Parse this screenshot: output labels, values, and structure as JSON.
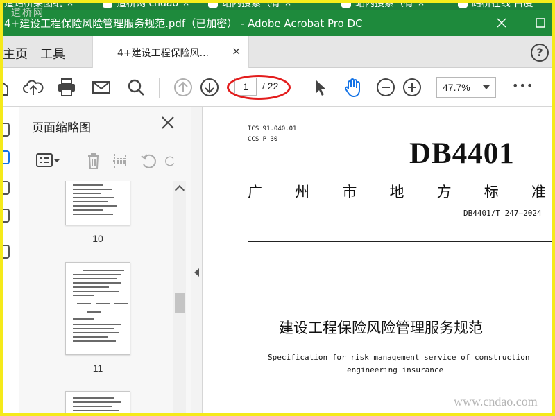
{
  "browser": {
    "tabs": [
      {
        "label": "道路桥梁图纸",
        "close": "×"
      },
      {
        "label": "道桥网 cndao",
        "close": "×"
      },
      {
        "label": "站内搜索（有",
        "close": "×"
      },
      {
        "label": "站内搜索（有",
        "close": "×"
      },
      {
        "label": "路桥在线 百度",
        "close": ""
      }
    ],
    "watermark": "道桥网"
  },
  "window": {
    "title": "4+建设工程保险风险管理服务规范.pdf（已加密） - Adobe Acrobat Pro DC"
  },
  "app_tabs": {
    "home": "主页",
    "tools": "工具",
    "doc_tab": "4+建设工程保险风...",
    "doc_close": "×",
    "help": "?"
  },
  "toolbar": {
    "current_page": "1",
    "total_pages": "/ 22",
    "zoom": "47.7%",
    "more": "•••"
  },
  "sidebar": {
    "title": "页面缩略图",
    "close": "×",
    "thumbnails": [
      {
        "page": "10"
      },
      {
        "page": "11"
      },
      {
        "page": ""
      }
    ]
  },
  "document": {
    "ics": "ICS 91.040.01",
    "ccs": "CCS P 30",
    "standard_code": "DB4401",
    "standard_type_chars": [
      "广",
      "州",
      "市",
      "地",
      "方",
      "标",
      "准"
    ],
    "doc_number": "DB4401/T 247—2024",
    "title_cn": "建设工程保险风险管理服务规范",
    "title_en_line1": "Specification for risk management service of construction",
    "title_en_line2": "engineering insurance",
    "watermark": "www.cndao.com"
  },
  "colors": {
    "title_bar": "#1e8a3c",
    "highlight_circle": "#e31d1d",
    "frame": "#f5ea1a",
    "hand_tool": "#1473e6"
  }
}
